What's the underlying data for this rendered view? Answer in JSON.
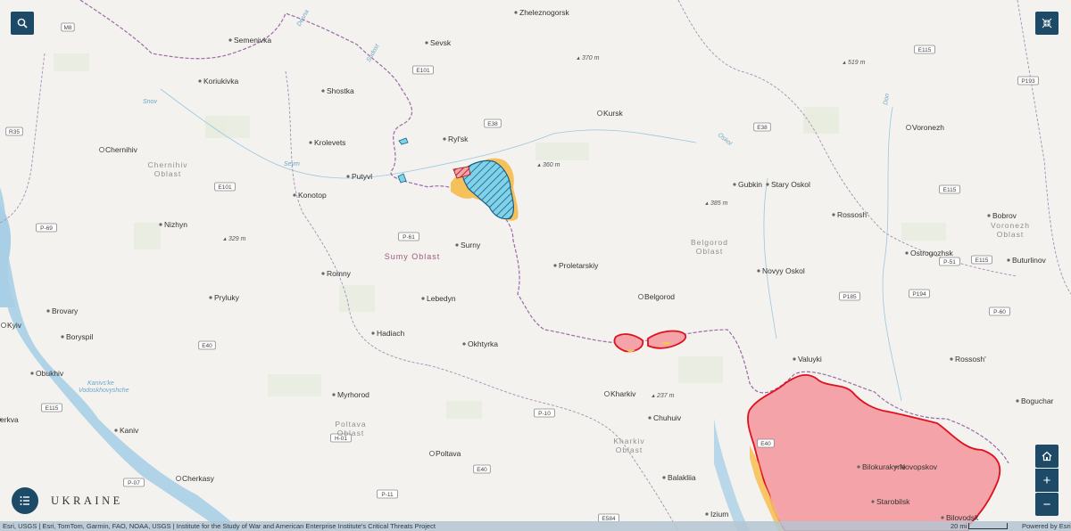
{
  "map": {
    "title": "UKRAINE",
    "attribution": "Esri, USGS | Esri, TomTom, Garmin, FAO, NOAA, USGS | Institute for the Study of War and American Enterprise Institute's Critical Threats Project",
    "scale_label": "20 mi",
    "powered_by": "Powered by Esri",
    "colors": {
      "background": "#f3f2ee",
      "control_bg": "#1d4a66",
      "occupied_fill": "#f4a3a8",
      "occupied_stroke": "#e0101f",
      "advance_fill": "#f6c15a",
      "ukr_incursion_fill": "#7fd2e8",
      "ukr_incursion_stroke": "#1b5f86",
      "border": "#9b6aa8",
      "water": "#a9cfe6"
    },
    "cities": [
      "Zheleznogorsk",
      "Semenivka",
      "Sevsk",
      "Koriukivka",
      "Shostka",
      "Kursk",
      "Voronezh",
      "Chernihiv",
      "Krolevets",
      "Ryl'sk",
      "Putyvl",
      "Konotop",
      "Gubkin",
      "Stary Oskol",
      "Nizhyn",
      "Rossosh'",
      "Bobrov",
      "Surny",
      "Proletarskiy",
      "Ostrogozhsk",
      "Romny",
      "Novyy Oskol",
      "Buturlinov",
      "Pryluky",
      "Belgorod",
      "Kyiv",
      "Brovary",
      "Lebedyn",
      "Boryspil",
      "Hadiach",
      "Okhtyrka",
      "Valuyki",
      "Rossosh'",
      "Obukhiv",
      "Kharkiv",
      "Myrhorod",
      "Chuhuiv",
      "Boguchar",
      "Kaniv",
      "Poltava",
      "Bilokurakyne",
      "Novopskov",
      "Balakliia",
      "Cherkasy",
      "Starobilsk",
      "Izium",
      "Bilovodsk",
      "erkva"
    ],
    "oblasts": {
      "chernihiv": [
        "Chernihiv",
        "Oblast"
      ],
      "sumy": "Sumy Oblast",
      "belgorod": [
        "Belgorod",
        "Oblast"
      ],
      "voronezh": [
        "Voronezh",
        "Oblast"
      ],
      "poltava": [
        "Poltava",
        "Oblast"
      ],
      "kharkiv": [
        "Kharkiv",
        "Oblast"
      ]
    },
    "roads": [
      "M8",
      "E101",
      "E38",
      "E115",
      "P193",
      "R35",
      "E38",
      "E101",
      "E115",
      "P-69",
      "P-61",
      "E115",
      "P185",
      "P194",
      "E40",
      "P-60",
      "E115",
      "H-01",
      "E40",
      "P-07",
      "P-10",
      "E40",
      "P-11",
      "E584",
      "P-51"
    ],
    "elevations": [
      "370 m",
      "519 m",
      "360 m",
      "385 m",
      "329 m",
      "237 m"
    ],
    "water": [
      "Desna",
      "Seym",
      "Oskol",
      "Kanivs'ke",
      "Vodoskhovyshche",
      "Don",
      "Snov",
      "Sudost"
    ]
  },
  "controls": {
    "search_icon": "search-icon",
    "fullscreen_icon": "exit-fullscreen-icon",
    "home_icon": "home-icon",
    "zoom_in": "+",
    "zoom_out": "−",
    "legend_icon": "legend-list-icon"
  }
}
